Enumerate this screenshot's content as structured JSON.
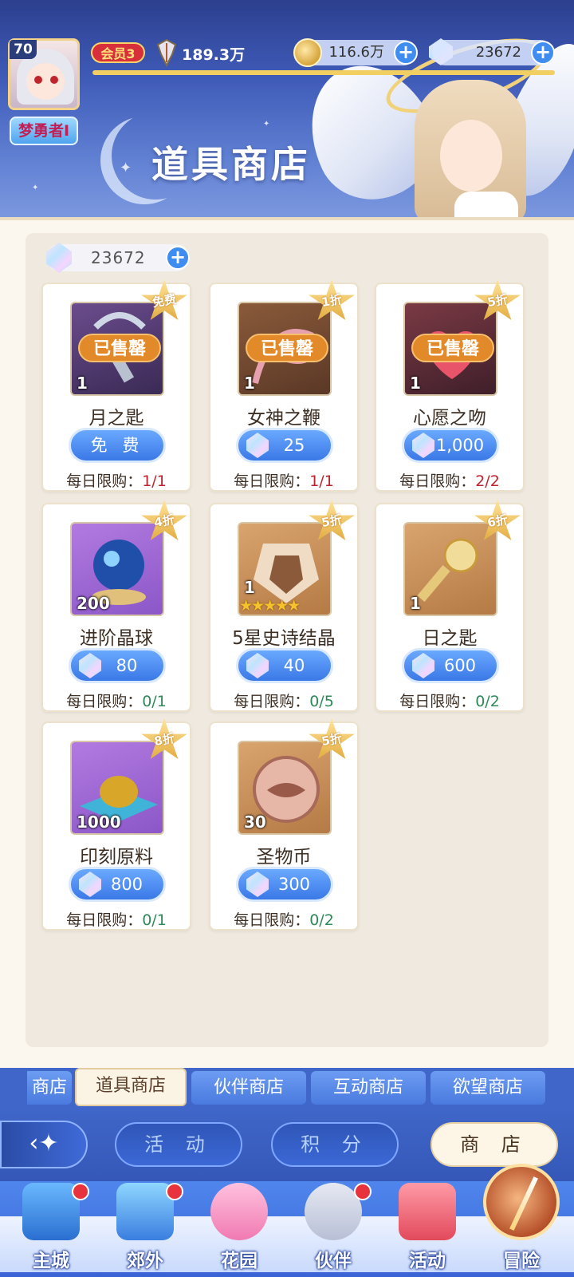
{
  "header": {
    "level": "70",
    "player_name": "梦勇者I",
    "vip": "会员3",
    "power": "189.3万",
    "coins": "116.6万",
    "gems": "23672",
    "title": "道具商店"
  },
  "panel": {
    "balance": "23672"
  },
  "items": [
    {
      "name": "月之匙",
      "qty": "1",
      "badge": "免费",
      "sold_out": "已售罄",
      "price": "免 费",
      "limit_label": "每日限购：",
      "limit_value": "1/1"
    },
    {
      "name": "女神之鞭",
      "qty": "1",
      "badge": "1折",
      "sold_out": "已售罄",
      "price": "25",
      "limit_label": "每日限购：",
      "limit_value": "1/1"
    },
    {
      "name": "心愿之吻",
      "qty": "1",
      "badge": "5折",
      "sold_out": "已售罄",
      "price": "1,000",
      "limit_label": "每日限购：",
      "limit_value": "2/2"
    },
    {
      "name": "进阶晶球",
      "qty": "200",
      "badge": "4折",
      "price": "80",
      "limit_label": "每日限购：",
      "limit_value": "0/1"
    },
    {
      "name": "5星史诗结晶",
      "qty": "1",
      "badge": "5折",
      "price": "40",
      "limit_label": "每日限购：",
      "limit_value": "0/5",
      "stars": "★★★★★"
    },
    {
      "name": "日之匙",
      "qty": "1",
      "badge": "6折",
      "price": "600",
      "limit_label": "每日限购：",
      "limit_value": "0/2"
    },
    {
      "name": "印刻原料",
      "qty": "1000",
      "badge": "8折",
      "price": "800",
      "limit_label": "每日限购：",
      "limit_value": "0/1"
    },
    {
      "name": "圣物币",
      "qty": "30",
      "badge": "5折",
      "price": "300",
      "limit_label": "每日限购：",
      "limit_value": "0/2"
    }
  ],
  "tabs": [
    "商店",
    "道具商店",
    "伙伴商店",
    "互动商店",
    "欲望商店"
  ],
  "subnav": [
    "活 动",
    "积 分",
    "商 店"
  ],
  "bottom_nav": [
    "主城",
    "郊外",
    "花园",
    "伙伴",
    "活动",
    "冒险"
  ],
  "colors": {
    "accent_blue": "#3a78e6",
    "sold_out_orange": "#e2892a",
    "limit_full_red": "#c0212e",
    "limit_available_green": "#2e8a58"
  }
}
